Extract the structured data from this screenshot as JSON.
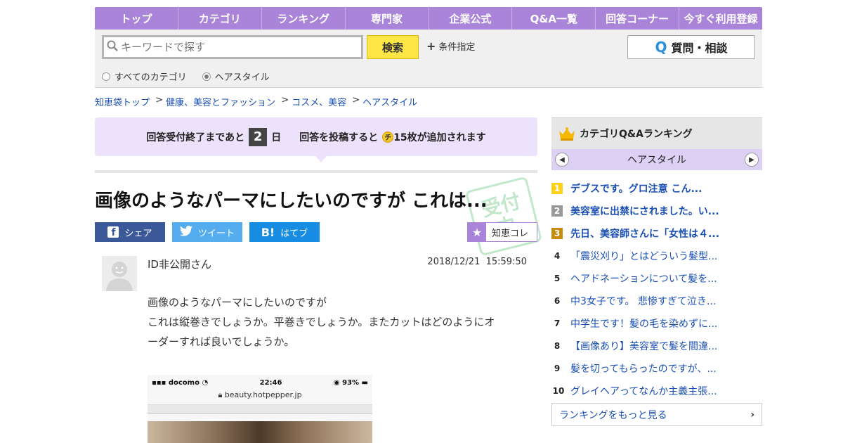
{
  "nav": {
    "items": [
      "トップ",
      "カテゴリ",
      "ランキング",
      "専門家",
      "企業公式",
      "Q&A一覧",
      "回答コーナー",
      "今すぐ利用登録"
    ]
  },
  "search": {
    "placeholder": "キーワードで探す",
    "button_label": "検索",
    "conditions_label": "条件指定",
    "ask_button_label": "質問・相談",
    "scope_all": "すべてのカテゴリ",
    "scope_current": "ヘアスタイル",
    "selected_scope": "current"
  },
  "breadcrumb": [
    "知恵袋トップ",
    "健康、美容とファッション",
    "コスメ、美容",
    "ヘアスタイル"
  ],
  "notice": {
    "prefix": "回答受付終了まであと",
    "days": "2",
    "day_unit": "日",
    "reward_prefix": "回答を投稿すると",
    "coin_glyph": "チ",
    "reward_suffix": "15枚が追加されます"
  },
  "question": {
    "title": "画像のようなパーマにしたいのですが これは...",
    "stamp_text_1": "受付",
    "stamp_text_2": "中",
    "user": "ID非公開さん",
    "date": "2018/12/21",
    "time": "15:59:50",
    "body_lines": [
      "画像のようなパーマにしたいのですが",
      "これは縦巻きでしょうか。平巻きでしょうか。またカットはどのようにオ",
      "ーダーすれば良いでしょうか。"
    ]
  },
  "share": {
    "facebook": "シェア",
    "twitter": "ツイート",
    "hatena": "はてブ",
    "hatena_icon": "B!",
    "chiekore": "知恵コレ"
  },
  "phone_shot": {
    "carrier": "docomo",
    "time": "22:46",
    "battery": "93%",
    "url": "beauty.hotpepper.jp"
  },
  "ranking": {
    "title": "カテゴリQ&Aランキング",
    "category": "ヘアスタイル",
    "items": [
      {
        "rank": "1",
        "text": "デブスです。グロ注意 こん..."
      },
      {
        "rank": "2",
        "text": "美容室に出禁にされました。い..."
      },
      {
        "rank": "3",
        "text": "先日、美容師さんに「女性は４..."
      },
      {
        "rank": "4",
        "text": "「震災刈り」とはどういう髪型..."
      },
      {
        "rank": "5",
        "text": "ヘアドネーションについて髪を..."
      },
      {
        "rank": "6",
        "text": "中3女子です。 悲惨すぎて泣き..."
      },
      {
        "rank": "7",
        "text": "中学生です！髪の毛を染めずに..."
      },
      {
        "rank": "8",
        "text": "【画像あり】美容室で髪を間違..."
      },
      {
        "rank": "9",
        "text": "髪を切ってもらったのですが、..."
      },
      {
        "rank": "10",
        "text": "グレイヘアってなんか主義主張..."
      }
    ],
    "more_label": "ランキングをもっと見る"
  }
}
